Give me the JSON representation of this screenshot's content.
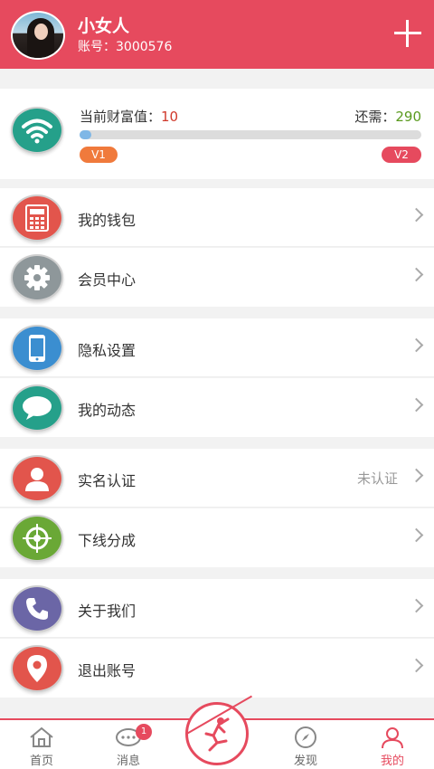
{
  "header": {
    "username": "小女人",
    "account": "账号：3000576"
  },
  "level": {
    "wealth_label": "当前财富值：",
    "wealth_value": "10",
    "need_label": "还需：",
    "need_value": "290",
    "progress_fraction": 0.034,
    "level_from": "V1",
    "level_to": "V2"
  },
  "menu": [
    {
      "label": "我的钱包",
      "icon": "calculator-icon",
      "color": "#e2554c"
    },
    {
      "label": "会员中心",
      "icon": "gear-icon",
      "color": "#8e979a"
    },
    {
      "label": "隐私设置",
      "icon": "phone-icon",
      "color": "#3b8ed0"
    },
    {
      "label": "我的动态",
      "icon": "chat-bubble-icon",
      "color": "#25a08a"
    },
    {
      "label": "实名认证",
      "status": "未认证",
      "icon": "user-icon",
      "color": "#e2554c"
    },
    {
      "label": "下线分成",
      "icon": "target-icon",
      "color": "#6aa836"
    },
    {
      "label": "关于我们",
      "icon": "phone-handset-icon",
      "color": "#6b66a6"
    },
    {
      "label": "退出账号",
      "icon": "location-pin-icon",
      "color": "#e2554c"
    }
  ],
  "nav": {
    "home": "首页",
    "messages": "消息",
    "messages_badge": "1",
    "discover": "发现",
    "mine": "我的"
  },
  "colors": {
    "accent": "#e64a5e",
    "wifi_circle": "#25a08a"
  }
}
